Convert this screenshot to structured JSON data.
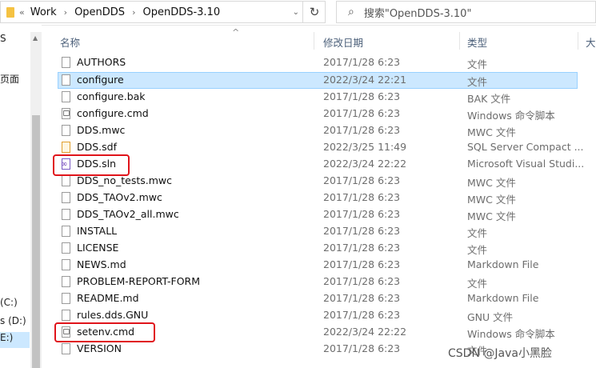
{
  "address": {
    "crumbs": [
      "Work",
      "OpenDDS",
      "OpenDDS-3.10"
    ],
    "overflow": "«",
    "search_placeholder": "搜索\"OpenDDS-3.10\""
  },
  "nav": {
    "items": [
      "S",
      "页面",
      "(C:)",
      "s (D:)",
      "E:)"
    ]
  },
  "columns": {
    "name": "名称",
    "date": "修改日期",
    "type": "类型",
    "size": "大"
  },
  "files": [
    {
      "name": "AUTHORS",
      "date": "2017/1/28 6:23",
      "type": "文件",
      "icon": "file-icon"
    },
    {
      "name": "configure",
      "date": "2022/3/24 22:21",
      "type": "文件",
      "icon": "file-icon",
      "selected": true
    },
    {
      "name": "configure.bak",
      "date": "2017/1/28 6:23",
      "type": "BAK 文件",
      "icon": "file-icon"
    },
    {
      "name": "configure.cmd",
      "date": "2017/1/28 6:23",
      "type": "Windows 命令脚本",
      "icon": "cmd-icon"
    },
    {
      "name": "DDS.mwc",
      "date": "2017/1/28 6:23",
      "type": "MWC 文件",
      "icon": "file-icon"
    },
    {
      "name": "DDS.sdf",
      "date": "2022/3/25 11:49",
      "type": "SQL Server Compact ...",
      "icon": "sdf-icon"
    },
    {
      "name": "DDS.sln",
      "date": "2022/3/24 22:22",
      "type": "Microsoft Visual Studi...",
      "icon": "sln-icon"
    },
    {
      "name": "DDS_no_tests.mwc",
      "date": "2017/1/28 6:23",
      "type": "MWC 文件",
      "icon": "file-icon"
    },
    {
      "name": "DDS_TAOv2.mwc",
      "date": "2017/1/28 6:23",
      "type": "MWC 文件",
      "icon": "file-icon"
    },
    {
      "name": "DDS_TAOv2_all.mwc",
      "date": "2017/1/28 6:23",
      "type": "MWC 文件",
      "icon": "file-icon"
    },
    {
      "name": "INSTALL",
      "date": "2017/1/28 6:23",
      "type": "文件",
      "icon": "file-icon"
    },
    {
      "name": "LICENSE",
      "date": "2017/1/28 6:23",
      "type": "文件",
      "icon": "file-icon"
    },
    {
      "name": "NEWS.md",
      "date": "2017/1/28 6:23",
      "type": "Markdown File",
      "icon": "md-icon"
    },
    {
      "name": "PROBLEM-REPORT-FORM",
      "date": "2017/1/28 6:23",
      "type": "文件",
      "icon": "file-icon"
    },
    {
      "name": "README.md",
      "date": "2017/1/28 6:23",
      "type": "Markdown File",
      "icon": "md-icon"
    },
    {
      "name": "rules.dds.GNU",
      "date": "2017/1/28 6:23",
      "type": "GNU 文件",
      "icon": "file-icon"
    },
    {
      "name": "setenv.cmd",
      "date": "2022/3/24 22:22",
      "type": "Windows 命令脚本",
      "icon": "cmd-icon"
    },
    {
      "name": "VERSION",
      "date": "2017/1/28 6:23",
      "type": "文件",
      "icon": "file-icon"
    }
  ],
  "watermark": "CSDN @Java小黑脸",
  "colors": {
    "selection": "#cce8ff",
    "callout": "#e0141b"
  }
}
